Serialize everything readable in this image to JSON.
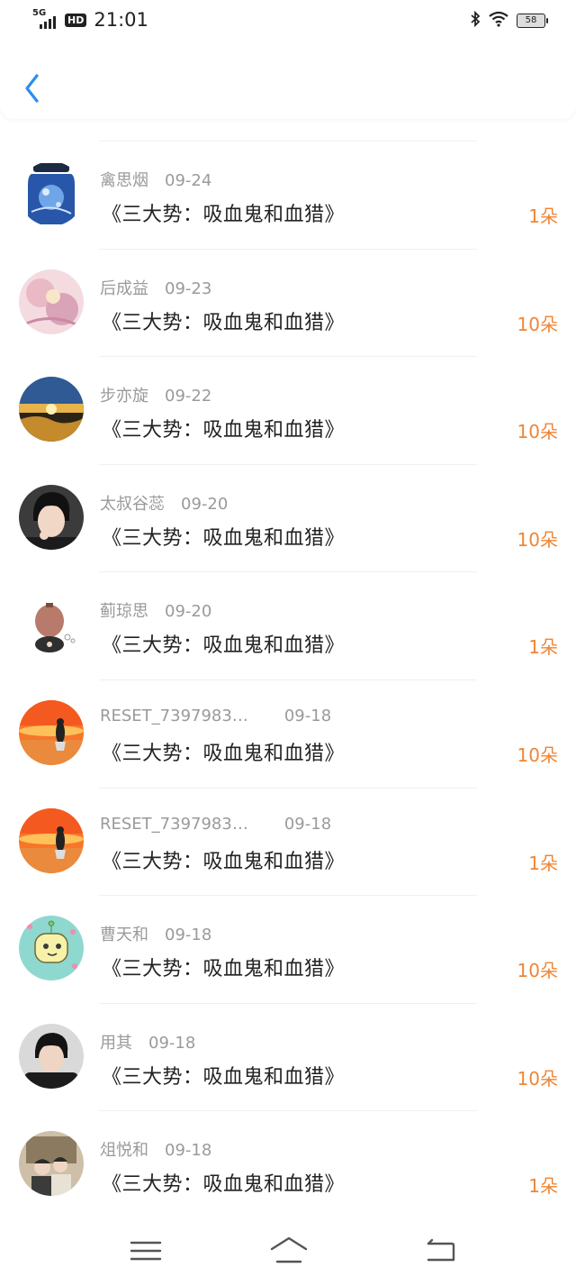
{
  "status_bar": {
    "network": "5G",
    "hd": "HD",
    "time": "21:01",
    "battery": "58"
  },
  "header": {
    "back_icon": "chevron-left-icon"
  },
  "colors": {
    "accent": "#2b8cf0",
    "amount": "#f08534",
    "meta": "#9a9a9a"
  },
  "items": [
    {
      "name": "禽思烟",
      "date": "09-24",
      "title": "《三大势：吸血鬼和血猎》",
      "amount": "1朵"
    },
    {
      "name": "后成益",
      "date": "09-23",
      "title": "《三大势：吸血鬼和血猎》",
      "amount": "10朵"
    },
    {
      "name": "步亦旋",
      "date": "09-22",
      "title": "《三大势：吸血鬼和血猎》",
      "amount": "10朵"
    },
    {
      "name": "太叔谷蕊",
      "date": "09-20",
      "title": "《三大势：吸血鬼和血猎》",
      "amount": "10朵"
    },
    {
      "name": "蓟琼思",
      "date": "09-20",
      "title": "《三大势：吸血鬼和血猎》",
      "amount": "1朵"
    },
    {
      "name": "RESET_7397983…",
      "date": "09-18",
      "title": "《三大势：吸血鬼和血猎》",
      "amount": "10朵"
    },
    {
      "name": "RESET_7397983…",
      "date": "09-18",
      "title": "《三大势：吸血鬼和血猎》",
      "amount": "1朵"
    },
    {
      "name": "曹天和",
      "date": "09-18",
      "title": "《三大势：吸血鬼和血猎》",
      "amount": "10朵"
    },
    {
      "name": "用其",
      "date": "09-18",
      "title": "《三大势：吸血鬼和血猎》",
      "amount": "10朵"
    },
    {
      "name": "俎悦和",
      "date": "09-18",
      "title": "《三大势：吸血鬼和血猎》",
      "amount": "1朵"
    }
  ],
  "nav": {
    "menu_icon": "menu-icon",
    "home_icon": "home-icon",
    "back_icon": "return-icon"
  }
}
